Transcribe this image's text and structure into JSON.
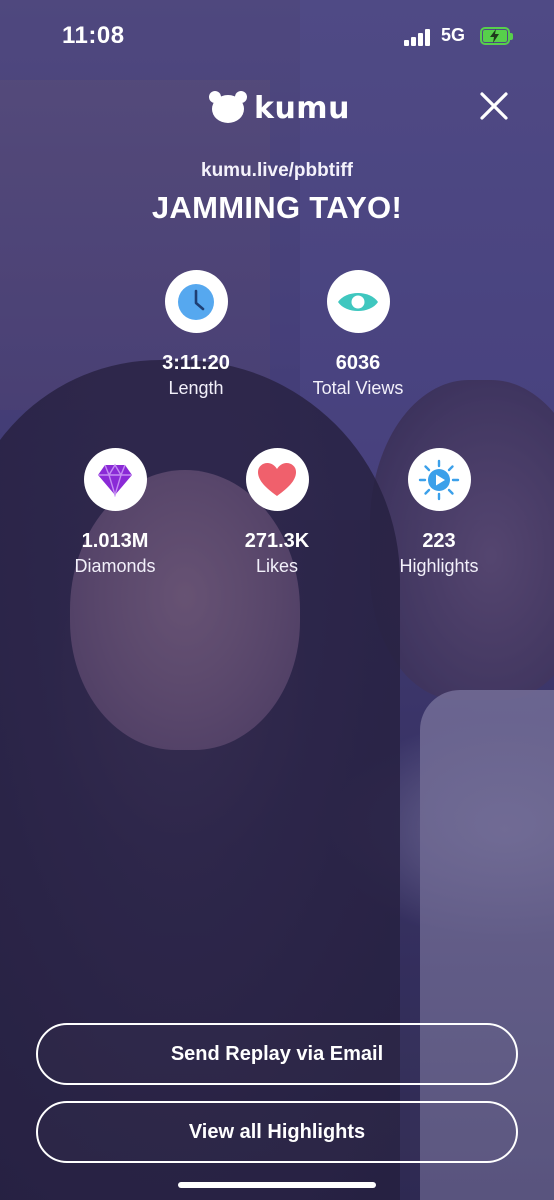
{
  "status_bar": {
    "time": "11:08",
    "network": "5G",
    "battery_color": "#57d04b"
  },
  "header": {
    "logo_text": "kumu",
    "close_icon": "close-icon"
  },
  "stream": {
    "url": "kumu.live/pbbtiff",
    "title": "JAMMING TAYO!"
  },
  "stats": {
    "length": {
      "value": "3:11:20",
      "label": "Length",
      "icon": "clock-icon",
      "color": "#56a8ef"
    },
    "views": {
      "value": "6036",
      "label": "Total Views",
      "icon": "eye-icon",
      "color": "#3fc7bf"
    },
    "diamonds": {
      "value": "1.013M",
      "label": "Diamonds",
      "icon": "diamond-icon",
      "color": "#8a2ad6"
    },
    "likes": {
      "value": "271.3K",
      "label": "Likes",
      "icon": "heart-icon",
      "color": "#f0606c"
    },
    "highlights": {
      "value": "223",
      "label": "Highlights",
      "icon": "highlight-play-icon",
      "color": "#3ba0ea"
    }
  },
  "actions": {
    "send_replay": "Send Replay via Email",
    "view_highlights": "View all Highlights"
  }
}
